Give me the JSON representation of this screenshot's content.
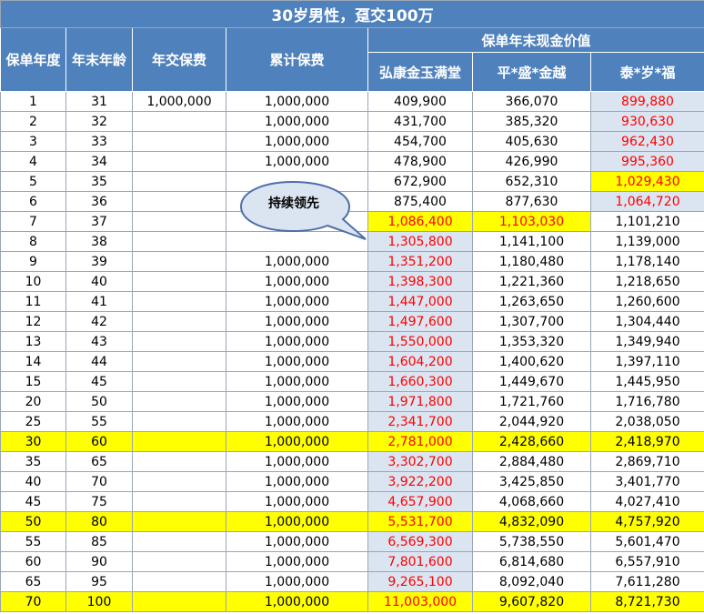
{
  "title": "30岁男性，趸交100万",
  "headers": {
    "year": "保单年度",
    "age": "年末年龄",
    "annual": "年交保费",
    "cumulative": "累计保费",
    "cash_value_group": "保单年末现金价值",
    "p1": "弘康金玉满堂",
    "p2": "平*盛*金越",
    "p3": "泰*岁*福"
  },
  "callout": "持续领先",
  "colors": {
    "header": "#4f81bd",
    "highlight_yellow": "#ffff00",
    "highlight_blue": "#dbe5f1",
    "emphasis_red": "#ff0000"
  },
  "rows": [
    {
      "year": "1",
      "age": "31",
      "annual": "1,000,000",
      "cumulative": "1,000,000",
      "p1": "409,900",
      "p2": "366,070",
      "p3": "899,880",
      "row_yellow": false,
      "p1_style": "",
      "p2_style": "",
      "p3_style": "red-blue"
    },
    {
      "year": "2",
      "age": "32",
      "annual": "",
      "cumulative": "1,000,000",
      "p1": "431,700",
      "p2": "385,320",
      "p3": "930,630",
      "row_yellow": false,
      "p1_style": "",
      "p2_style": "",
      "p3_style": "red-blue"
    },
    {
      "year": "3",
      "age": "33",
      "annual": "",
      "cumulative": "1,000,000",
      "p1": "454,700",
      "p2": "405,630",
      "p3": "962,430",
      "row_yellow": false,
      "p1_style": "",
      "p2_style": "",
      "p3_style": "red-blue"
    },
    {
      "year": "4",
      "age": "34",
      "annual": "",
      "cumulative": "1,000,000",
      "p1": "478,900",
      "p2": "426,990",
      "p3": "995,360",
      "row_yellow": false,
      "p1_style": "",
      "p2_style": "",
      "p3_style": "red-blue"
    },
    {
      "year": "5",
      "age": "35",
      "annual": "",
      "cumulative": "",
      "p1": "672,900",
      "p2": "652,310",
      "p3": "1,029,430",
      "row_yellow": false,
      "p1_style": "",
      "p2_style": "",
      "p3_style": "red-yellow"
    },
    {
      "year": "6",
      "age": "36",
      "annual": "",
      "cumulative": "",
      "p1": "875,400",
      "p2": "877,630",
      "p3": "1,064,720",
      "row_yellow": false,
      "p1_style": "",
      "p2_style": "",
      "p3_style": "red-blue"
    },
    {
      "year": "7",
      "age": "37",
      "annual": "",
      "cumulative": "",
      "p1": "1,086,400",
      "p2": "1,103,030",
      "p3": "1,101,210",
      "row_yellow": false,
      "p1_style": "red-yellow",
      "p2_style": "red-yellow",
      "p3_style": ""
    },
    {
      "year": "8",
      "age": "38",
      "annual": "",
      "cumulative": "",
      "p1": "1,305,800",
      "p2": "1,141,100",
      "p3": "1,139,000",
      "row_yellow": false,
      "p1_style": "red-blue",
      "p2_style": "",
      "p3_style": ""
    },
    {
      "year": "9",
      "age": "39",
      "annual": "",
      "cumulative": "1,000,000",
      "p1": "1,351,200",
      "p2": "1,180,480",
      "p3": "1,178,140",
      "row_yellow": false,
      "p1_style": "red-blue",
      "p2_style": "",
      "p3_style": ""
    },
    {
      "year": "10",
      "age": "40",
      "annual": "",
      "cumulative": "1,000,000",
      "p1": "1,398,300",
      "p2": "1,221,360",
      "p3": "1,218,650",
      "row_yellow": false,
      "p1_style": "red-blue",
      "p2_style": "",
      "p3_style": ""
    },
    {
      "year": "11",
      "age": "41",
      "annual": "",
      "cumulative": "1,000,000",
      "p1": "1,447,000",
      "p2": "1,263,650",
      "p3": "1,260,600",
      "row_yellow": false,
      "p1_style": "red-blue",
      "p2_style": "",
      "p3_style": ""
    },
    {
      "year": "12",
      "age": "42",
      "annual": "",
      "cumulative": "1,000,000",
      "p1": "1,497,600",
      "p2": "1,307,700",
      "p3": "1,304,440",
      "row_yellow": false,
      "p1_style": "red-blue",
      "p2_style": "",
      "p3_style": ""
    },
    {
      "year": "13",
      "age": "43",
      "annual": "",
      "cumulative": "1,000,000",
      "p1": "1,550,000",
      "p2": "1,353,320",
      "p3": "1,349,940",
      "row_yellow": false,
      "p1_style": "red-blue",
      "p2_style": "",
      "p3_style": ""
    },
    {
      "year": "14",
      "age": "44",
      "annual": "",
      "cumulative": "1,000,000",
      "p1": "1,604,200",
      "p2": "1,400,620",
      "p3": "1,397,110",
      "row_yellow": false,
      "p1_style": "red-blue",
      "p2_style": "",
      "p3_style": ""
    },
    {
      "year": "15",
      "age": "45",
      "annual": "",
      "cumulative": "1,000,000",
      "p1": "1,660,300",
      "p2": "1,449,670",
      "p3": "1,445,950",
      "row_yellow": false,
      "p1_style": "red-blue",
      "p2_style": "",
      "p3_style": ""
    },
    {
      "year": "20",
      "age": "50",
      "annual": "",
      "cumulative": "1,000,000",
      "p1": "1,971,800",
      "p2": "1,721,760",
      "p3": "1,716,780",
      "row_yellow": false,
      "p1_style": "red-blue",
      "p2_style": "",
      "p3_style": ""
    },
    {
      "year": "25",
      "age": "55",
      "annual": "",
      "cumulative": "1,000,000",
      "p1": "2,341,700",
      "p2": "2,044,920",
      "p3": "2,038,050",
      "row_yellow": false,
      "p1_style": "red-blue",
      "p2_style": "",
      "p3_style": ""
    },
    {
      "year": "30",
      "age": "60",
      "annual": "",
      "cumulative": "1,000,000",
      "p1": "2,781,000",
      "p2": "2,428,660",
      "p3": "2,418,970",
      "row_yellow": true,
      "p1_style": "red",
      "p2_style": "",
      "p3_style": ""
    },
    {
      "year": "35",
      "age": "65",
      "annual": "",
      "cumulative": "1,000,000",
      "p1": "3,302,700",
      "p2": "2,884,480",
      "p3": "2,869,710",
      "row_yellow": false,
      "p1_style": "red-blue",
      "p2_style": "",
      "p3_style": ""
    },
    {
      "year": "40",
      "age": "70",
      "annual": "",
      "cumulative": "1,000,000",
      "p1": "3,922,200",
      "p2": "3,425,850",
      "p3": "3,401,770",
      "row_yellow": false,
      "p1_style": "red-blue",
      "p2_style": "",
      "p3_style": ""
    },
    {
      "year": "45",
      "age": "75",
      "annual": "",
      "cumulative": "1,000,000",
      "p1": "4,657,900",
      "p2": "4,068,660",
      "p3": "4,027,410",
      "row_yellow": false,
      "p1_style": "red-blue",
      "p2_style": "",
      "p3_style": ""
    },
    {
      "year": "50",
      "age": "80",
      "annual": "",
      "cumulative": "1,000,000",
      "p1": "5,531,700",
      "p2": "4,832,090",
      "p3": "4,757,920",
      "row_yellow": true,
      "p1_style": "red",
      "p2_style": "",
      "p3_style": ""
    },
    {
      "year": "55",
      "age": "85",
      "annual": "",
      "cumulative": "1,000,000",
      "p1": "6,569,300",
      "p2": "5,738,550",
      "p3": "5,601,470",
      "row_yellow": false,
      "p1_style": "red-blue",
      "p2_style": "",
      "p3_style": ""
    },
    {
      "year": "60",
      "age": "90",
      "annual": "",
      "cumulative": "1,000,000",
      "p1": "7,801,600",
      "p2": "6,814,680",
      "p3": "6,557,910",
      "row_yellow": false,
      "p1_style": "red-blue",
      "p2_style": "",
      "p3_style": ""
    },
    {
      "year": "65",
      "age": "95",
      "annual": "",
      "cumulative": "1,000,000",
      "p1": "9,265,100",
      "p2": "8,092,040",
      "p3": "7,611,280",
      "row_yellow": false,
      "p1_style": "red-blue",
      "p2_style": "",
      "p3_style": ""
    },
    {
      "year": "70",
      "age": "100",
      "annual": "",
      "cumulative": "1,000,000",
      "p1": "11,003,000",
      "p2": "9,607,820",
      "p3": "8,721,730",
      "row_yellow": true,
      "p1_style": "red",
      "p2_style": "",
      "p3_style": ""
    }
  ]
}
